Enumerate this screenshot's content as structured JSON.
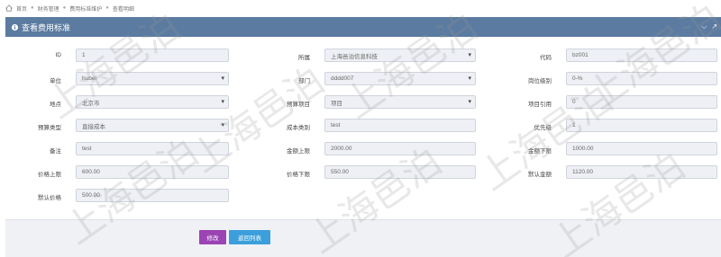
{
  "breadcrumb": [
    "首页",
    "财务管理",
    "费用标准维护",
    "查看明细"
  ],
  "panel": {
    "title": "查看费用标准",
    "tools": [
      "⌵",
      "↗"
    ]
  },
  "fields": {
    "id": {
      "label": "ID",
      "value": "1"
    },
    "company": {
      "label": "所属",
      "value": "上海邑泊信息科技"
    },
    "code": {
      "label": "代码",
      "value": "bz001"
    },
    "unit": {
      "label": "单位",
      "value": "hubei"
    },
    "dept": {
      "label": "部门",
      "value": "dddd007"
    },
    "post_level": {
      "label": "岗位级别",
      "value": "0-%"
    },
    "region": {
      "label": "地点",
      "value": "北京市"
    },
    "budget_item": {
      "label": "预算项目",
      "value": "项目"
    },
    "item_ref": {
      "label": "项目引用",
      "value": "0"
    },
    "budget_type": {
      "label": "预算类型",
      "value": "直接成本"
    },
    "cost_category": {
      "label": "成本类别",
      "value": "test"
    },
    "priority": {
      "label": "优先级",
      "value": "1"
    },
    "remark": {
      "label": "备注",
      "value": "test"
    },
    "amount_upper": {
      "label": "金额上限",
      "value": "2000.00"
    },
    "amount_lower": {
      "label": "金额下限",
      "value": "1000.00"
    },
    "price_upper": {
      "label": "价格上限",
      "value": "600.00"
    },
    "price_lower": {
      "label": "价格下限",
      "value": "550.00"
    },
    "default_amount": {
      "label": "默认金额",
      "value": "1120.00"
    },
    "default_price": {
      "label": "默认价格",
      "value": "500.00"
    }
  },
  "buttons": {
    "edit": "修改",
    "back": "返回列表"
  },
  "watermark": "上海邑泊",
  "colors": {
    "header": "#5b7ba0",
    "edit": "#9b44b3",
    "back": "#3b9fdc"
  }
}
